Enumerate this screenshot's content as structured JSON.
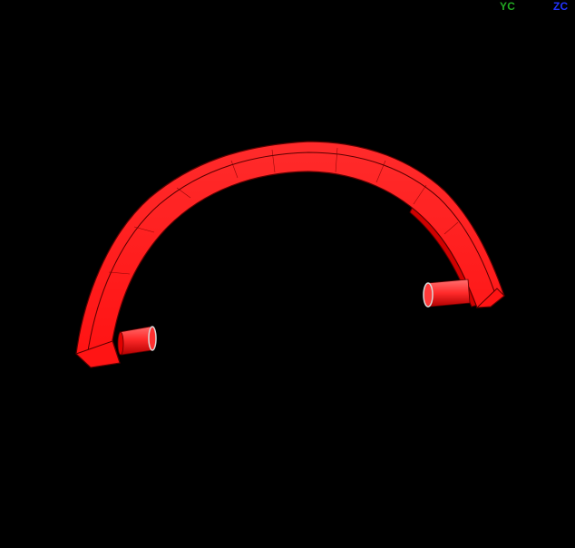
{
  "viewport": {
    "background_color": "#000000",
    "model": {
      "part": "semicircular-handle",
      "body_color": "#ff1a1a",
      "edge_color": "#5a0000",
      "pin_color": "#ff2424",
      "pin_end_color": "#d9d9d9"
    },
    "triad": {
      "yc": {
        "label": "YC",
        "color": "#22aa22"
      },
      "zc": {
        "label": "ZC",
        "color": "#2233ff"
      }
    }
  }
}
